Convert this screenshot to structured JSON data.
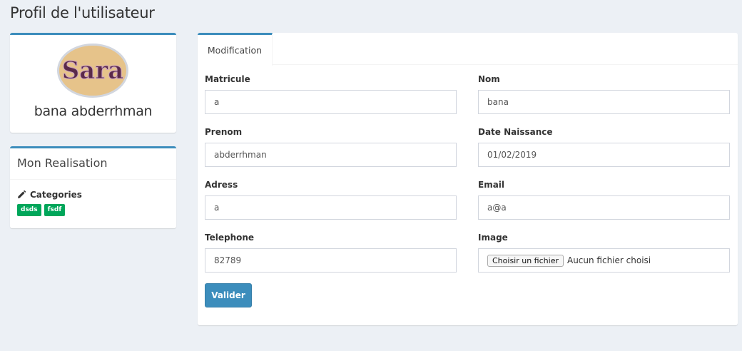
{
  "page": {
    "title": "Profil de l'utilisateur"
  },
  "profile": {
    "name": "bana abderrhman",
    "avatar_text": "Sara"
  },
  "realisation": {
    "title": "Mon Realisation",
    "categories_label": "Categories",
    "tags": [
      "dsds",
      "fsdf"
    ]
  },
  "tabs": [
    {
      "label": "Modification",
      "active": true
    }
  ],
  "form": {
    "matricule": {
      "label": "Matricule",
      "value": "a"
    },
    "nom": {
      "label": "Nom",
      "value": "bana"
    },
    "prenom": {
      "label": "Prenom",
      "value": "abderrhman"
    },
    "date_naissance": {
      "label": "Date Naissance",
      "value": "01/02/2019"
    },
    "adress": {
      "label": "Adress",
      "value": "a"
    },
    "email": {
      "label": "Email",
      "value": "a@a"
    },
    "telephone": {
      "label": "Telephone",
      "value": "82789"
    },
    "image": {
      "label": "Image",
      "button_label": "Choisir un fichier",
      "status": "Aucun fichier choisi"
    },
    "submit_label": "Valider"
  },
  "colors": {
    "primary": "#3c8dbc",
    "success": "#00a65a",
    "background": "#ecf0f5"
  },
  "icons": {
    "categories": "pencil-icon"
  }
}
